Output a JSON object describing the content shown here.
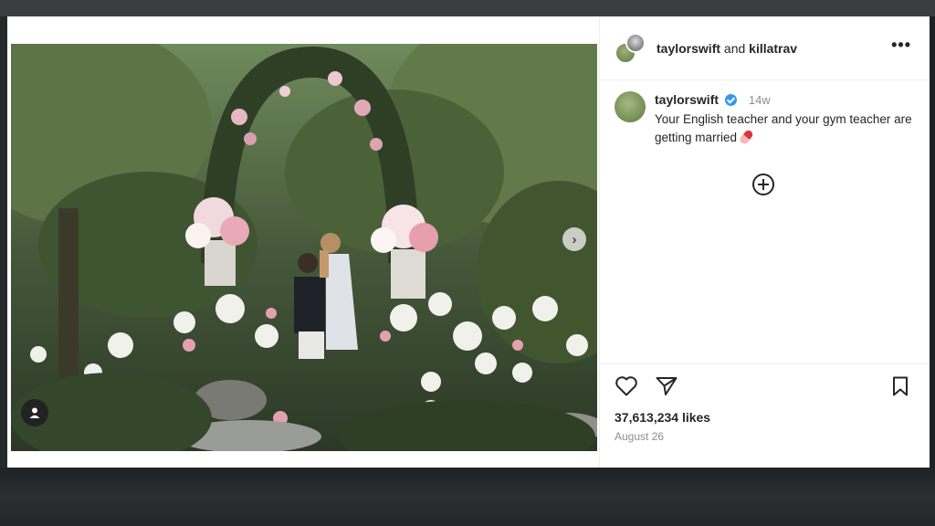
{
  "post": {
    "header": {
      "user1": "taylorswift",
      "conj": "and",
      "user2": "killatrav",
      "more_label": "•••"
    },
    "caption": {
      "username": "taylorswift",
      "time_ago": "14w",
      "text": "Your English teacher and your gym teacher are getting married"
    },
    "likes": "37,613,234 likes",
    "date": "August 26"
  },
  "icons": [
    "avatar",
    "verified-badge",
    "pill-emoji",
    "add-comment-icon",
    "heart-icon",
    "share-icon",
    "bookmark-icon",
    "next-arrow-icon",
    "user-tag-icon"
  ],
  "colors": {
    "verified": "#3897f0",
    "text": "#262626",
    "muted": "#8e8e8e"
  }
}
